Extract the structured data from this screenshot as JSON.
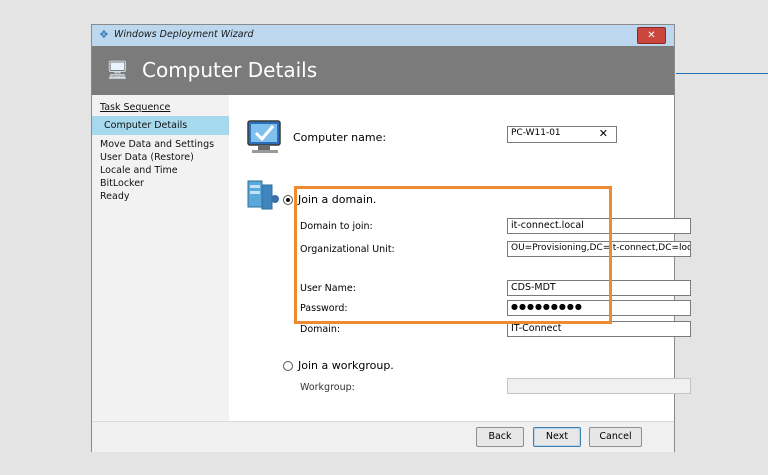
{
  "window": {
    "title": "Windows Deployment Wizard",
    "close_label": "✕"
  },
  "header": {
    "title": "Computer Details"
  },
  "sidebar": {
    "items": [
      {
        "label": "Task Sequence"
      },
      {
        "label": "Computer Details"
      },
      {
        "label": "Move Data and Settings"
      },
      {
        "label": "User Data (Restore)"
      },
      {
        "label": "Locale and Time"
      },
      {
        "label": "BitLocker"
      },
      {
        "label": "Ready"
      }
    ],
    "active_index": 1
  },
  "computer_name": {
    "label": "Computer name:",
    "value": "PC-W11-01",
    "clear_label": "✕"
  },
  "join_domain": {
    "label": "Join a domain.",
    "selected": true,
    "fields": [
      {
        "label": "Domain to join:",
        "value": "it-connect.local"
      },
      {
        "label": "Organizational Unit:",
        "value": "OU=Provisioning,DC=it-connect,DC=local"
      },
      {
        "label": "User Name:",
        "value": "CDS-MDT"
      },
      {
        "label": "Password:",
        "value": "●●●●●●●●●"
      },
      {
        "label": "Domain:",
        "value": "IT-Connect"
      }
    ]
  },
  "join_workgroup": {
    "label": "Join a workgroup.",
    "selected": false,
    "workgroup_label": "Workgroup:",
    "workgroup_value": ""
  },
  "footer": {
    "back_label": "Back",
    "next_label": "Next",
    "cancel_label": "Cancel"
  },
  "colors": {
    "accent": "#a6d9ee",
    "highlight_box": "#f08a30",
    "header_bg": "#7b7b7b",
    "titlebar_bg": "#bdd7ee"
  }
}
